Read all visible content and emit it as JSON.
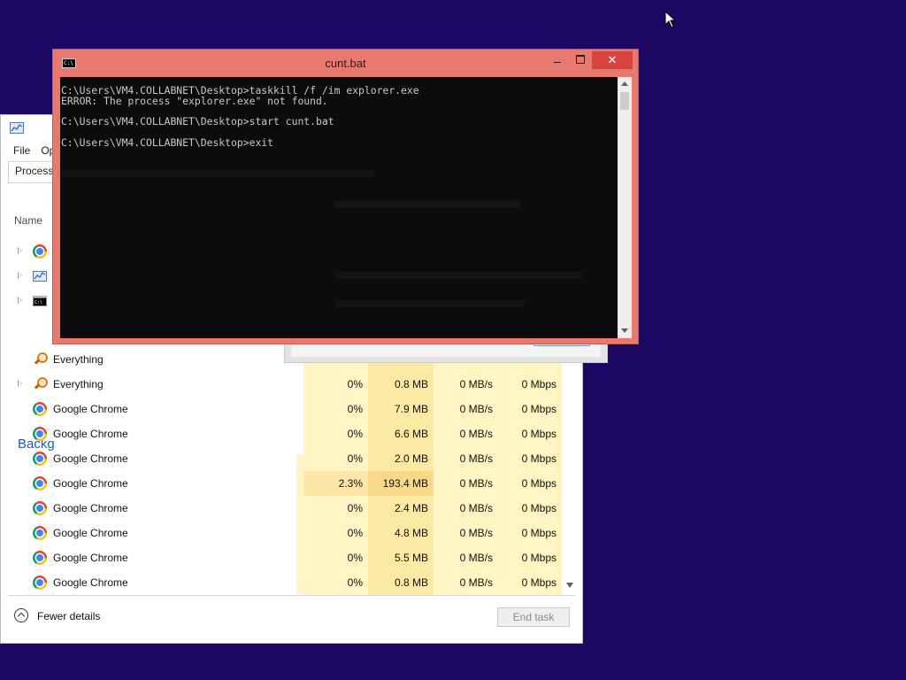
{
  "cmd_window": {
    "title": "cunt.bat",
    "icon_text": "C:\\",
    "close_glyph": "✕",
    "lines": [
      "C:\\Users\\VM4.COLLABNET\\Desktop>taskkill /f /im explorer.exe",
      "ERROR: The process \"explorer.exe\" not found.",
      "",
      "C:\\Users\\VM4.COLLABNET\\Desktop>start cunt.bat",
      "",
      "C:\\Users\\VM4.COLLABNET\\Desktop>exit"
    ]
  },
  "task_manager": {
    "menu": [
      "File",
      "Op"
    ],
    "active_tab": "Processe",
    "name_column": "Name",
    "section_label": "Backg",
    "processes": [
      {
        "name": "Everything",
        "icon": "search-icon",
        "expandable": false,
        "cpu": "",
        "memory": "",
        "disk": "",
        "network": ""
      },
      {
        "name": "Everything",
        "icon": "search-icon",
        "expandable": true,
        "cpu": "0%",
        "memory": "0.8 MB",
        "disk": "0 MB/s",
        "network": "0 Mbps"
      },
      {
        "name": "Google Chrome",
        "icon": "chrome-icon",
        "expandable": false,
        "cpu": "0%",
        "memory": "7.9 MB",
        "disk": "0 MB/s",
        "network": "0 Mbps"
      },
      {
        "name": "Google Chrome",
        "icon": "chrome-icon",
        "expandable": false,
        "cpu": "0%",
        "memory": "6.6 MB",
        "disk": "0 MB/s",
        "network": "0 Mbps"
      },
      {
        "name": "Google Chrome",
        "icon": "chrome-icon",
        "expandable": false,
        "cpu": "0%",
        "memory": "2.0 MB",
        "disk": "0 MB/s",
        "network": "0 Mbps"
      },
      {
        "name": "Google Chrome",
        "icon": "chrome-icon",
        "expandable": false,
        "cpu": "2.3%",
        "memory": "193.4 MB",
        "disk": "0 MB/s",
        "network": "0 Mbps",
        "hot": true
      },
      {
        "name": "Google Chrome",
        "icon": "chrome-icon",
        "expandable": false,
        "cpu": "0%",
        "memory": "2.4 MB",
        "disk": "0 MB/s",
        "network": "0 Mbps"
      },
      {
        "name": "Google Chrome",
        "icon": "chrome-icon",
        "expandable": false,
        "cpu": "0%",
        "memory": "4.8 MB",
        "disk": "0 MB/s",
        "network": "0 Mbps"
      },
      {
        "name": "Google Chrome",
        "icon": "chrome-icon",
        "expandable": false,
        "cpu": "0%",
        "memory": "5.5 MB",
        "disk": "0 MB/s",
        "network": "0 Mbps"
      },
      {
        "name": "Google Chrome",
        "icon": "chrome-icon",
        "expandable": false,
        "cpu": "0%",
        "memory": "0.8 MB",
        "disk": "0 MB/s",
        "network": "0 Mbps"
      }
    ],
    "fewer_details": "Fewer details",
    "end_task": "End task"
  }
}
